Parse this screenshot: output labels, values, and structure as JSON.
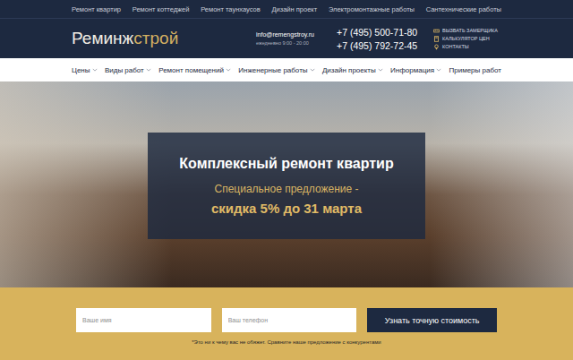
{
  "top_links": [
    "Ремонт квартир",
    "Ремонт коттеджей",
    "Ремонт таунхаусов",
    "Дизайн проект",
    "Электромонтажные работы",
    "Сантехнические работы"
  ],
  "logo": {
    "part1": "Реминж",
    "part2": "строй"
  },
  "contact": {
    "email": "info@remengstroy.ru",
    "hours": "ежедневно 9:00 - 20:00",
    "phones": [
      "+7 (495) 500-71-80",
      "+7 (495) 792-72-45"
    ]
  },
  "quick_links": [
    "ВЫЗВАТЬ ЗАМЕРЩИКА",
    "КАЛЬКУЛЯТОР ЦЕН",
    "КОНТАКТЫ"
  ],
  "nav": [
    {
      "label": "Цены",
      "dropdown": true
    },
    {
      "label": "Виды работ",
      "dropdown": true
    },
    {
      "label": "Ремонт помещений",
      "dropdown": true
    },
    {
      "label": "Инженерные работы",
      "dropdown": true
    },
    {
      "label": "Дизайн проекты",
      "dropdown": true
    },
    {
      "label": "Информация",
      "dropdown": true
    },
    {
      "label": "Примеры работ",
      "dropdown": false
    }
  ],
  "hero": {
    "title": "Комплексный ремонт квартир",
    "offer": "Специальное предложение -",
    "discount": "скидка 5% до 31 марта"
  },
  "form": {
    "fields": [
      {
        "placeholder": "Ваше имя"
      },
      {
        "placeholder": "Ваш телефон"
      }
    ],
    "button": "Узнать точную стоимость",
    "note": "*Это ни к чему вас не обяжет. Сравните наше предложение с конкурентами"
  }
}
